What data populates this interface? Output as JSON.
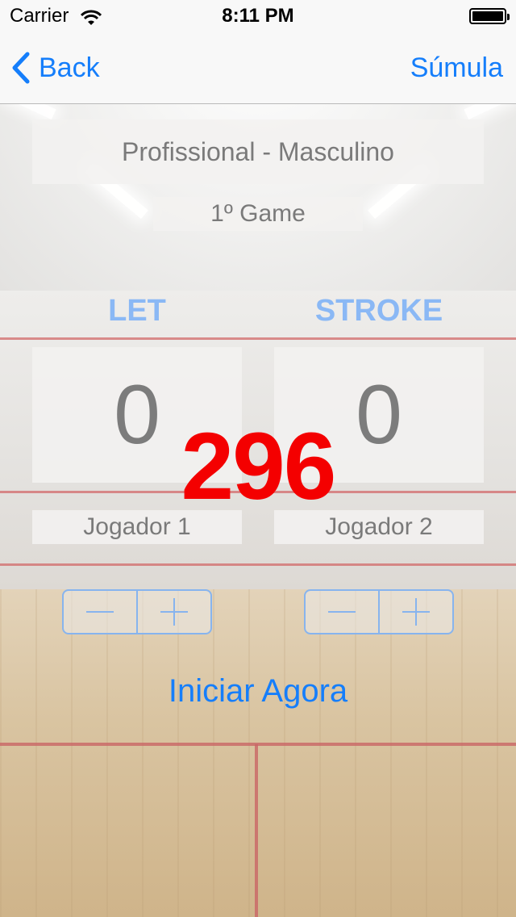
{
  "status_bar": {
    "carrier": "Carrier",
    "time": "8:11 PM"
  },
  "nav": {
    "back_label": "Back",
    "right_label": "Súmula"
  },
  "match": {
    "category": "Profissional - Masculino",
    "game": "1º Game"
  },
  "labels": {
    "let": "LET",
    "stroke": "STROKE"
  },
  "scores": {
    "player1": "0",
    "player2": "0"
  },
  "timer": "296",
  "players": {
    "player1": "Jogador 1",
    "player2": "Jogador 2"
  },
  "start_button": "Iniciar Agora",
  "colors": {
    "accent": "#157efb",
    "timer": "#f40000",
    "label": "#8ab8f5"
  }
}
